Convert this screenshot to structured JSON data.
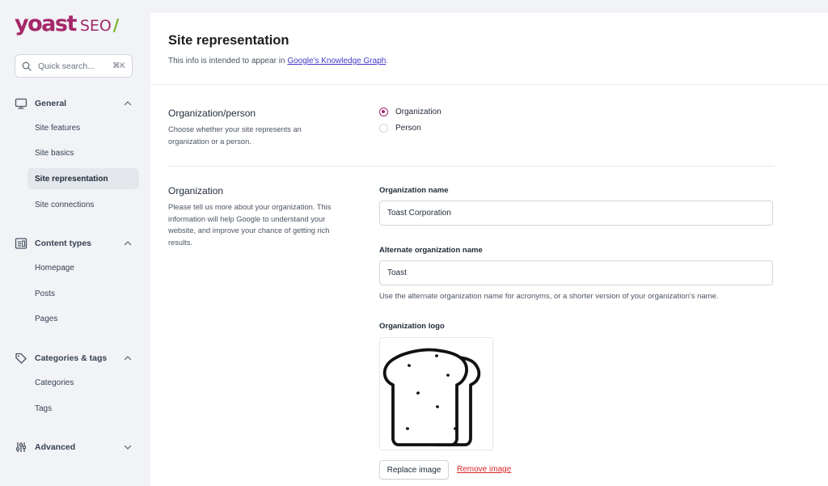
{
  "brand": {
    "name": "yoast",
    "product": "SEO",
    "slash": "/",
    "colors": {
      "primary": "#a4286a",
      "accent": "#77b227"
    }
  },
  "search": {
    "placeholder": "Quick search...",
    "shortcut": "⌘K"
  },
  "sidebar": {
    "groups": [
      {
        "label": "General",
        "icon": "monitor-icon",
        "expanded": true,
        "items": [
          {
            "label": "Site features"
          },
          {
            "label": "Site basics"
          },
          {
            "label": "Site representation",
            "active": true
          },
          {
            "label": "Site connections"
          }
        ]
      },
      {
        "label": "Content types",
        "icon": "content-types-icon",
        "expanded": true,
        "items": [
          {
            "label": "Homepage"
          },
          {
            "label": "Posts"
          },
          {
            "label": "Pages"
          }
        ]
      },
      {
        "label": "Categories & tags",
        "icon": "tag-icon",
        "expanded": true,
        "items": [
          {
            "label": "Categories"
          },
          {
            "label": "Tags"
          }
        ]
      },
      {
        "label": "Advanced",
        "icon": "sliders-icon",
        "expanded": false,
        "items": []
      }
    ]
  },
  "page": {
    "title": "Site representation",
    "description_prefix": "This info is intended to appear in ",
    "description_link": "Google's Knowledge Graph",
    "description_suffix": "."
  },
  "org_person": {
    "title": "Organization/person",
    "description": "Choose whether your site represents an organization or a person.",
    "options": [
      {
        "label": "Organization",
        "checked": true
      },
      {
        "label": "Person",
        "checked": false
      }
    ]
  },
  "organization": {
    "title": "Organization",
    "description": "Please tell us more about your organization. This information will help Google to understand your website, and improve your chance of getting rich results.",
    "name_label": "Organization name",
    "name_value": "Toast Corporation",
    "alt_label": "Alternate organization name",
    "alt_value": "Toast",
    "alt_help": "Use the alternate organization name for acronyms, or a shorter version of your organization's name.",
    "logo_label": "Organization logo",
    "logo_icon": "bread-toast-icon",
    "replace_label": "Replace image",
    "remove_label": "Remove image"
  }
}
